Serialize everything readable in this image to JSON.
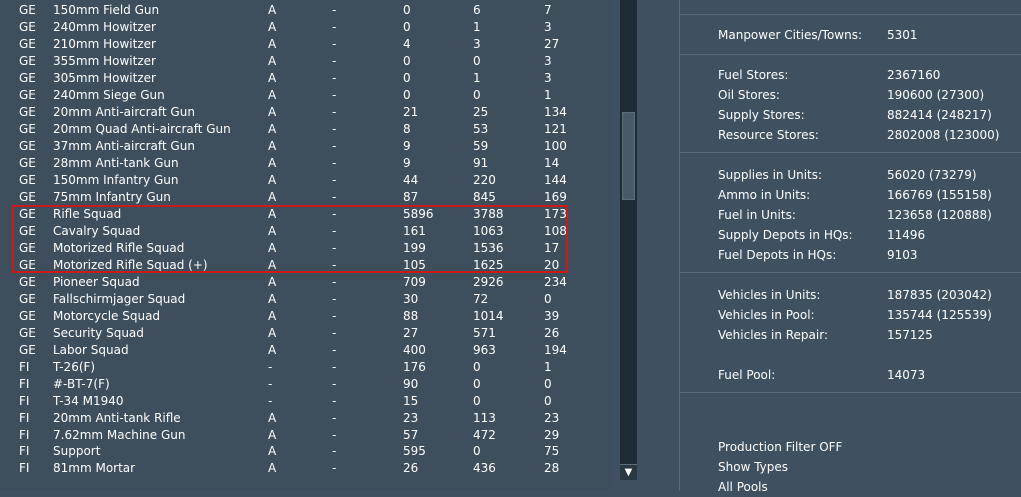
{
  "table": {
    "rows": [
      {
        "nat": "GE",
        "name": "150mm Field Gun",
        "a": "A",
        "d": "-",
        "n1": "0",
        "n2": "6",
        "n3": "7"
      },
      {
        "nat": "GE",
        "name": "240mm Howitzer",
        "a": "A",
        "d": "-",
        "n1": "0",
        "n2": "1",
        "n3": "3"
      },
      {
        "nat": "GE",
        "name": "210mm Howitzer",
        "a": "A",
        "d": "-",
        "n1": "4",
        "n2": "3",
        "n3": "27"
      },
      {
        "nat": "GE",
        "name": "355mm Howitzer",
        "a": "A",
        "d": "-",
        "n1": "0",
        "n2": "0",
        "n3": "3"
      },
      {
        "nat": "GE",
        "name": "305mm Howitzer",
        "a": "A",
        "d": "-",
        "n1": "0",
        "n2": "1",
        "n3": "3"
      },
      {
        "nat": "GE",
        "name": "240mm Siege Gun",
        "a": "A",
        "d": "-",
        "n1": "0",
        "n2": "0",
        "n3": "1"
      },
      {
        "nat": "GE",
        "name": "20mm Anti-aircraft Gun",
        "a": "A",
        "d": "-",
        "n1": "21",
        "n2": "25",
        "n3": "134"
      },
      {
        "nat": "GE",
        "name": "20mm Quad Anti-aircraft Gun",
        "a": "A",
        "d": "-",
        "n1": "8",
        "n2": "53",
        "n3": "121"
      },
      {
        "nat": "GE",
        "name": "37mm Anti-aircraft Gun",
        "a": "A",
        "d": "-",
        "n1": "9",
        "n2": "59",
        "n3": "100"
      },
      {
        "nat": "GE",
        "name": "28mm Anti-tank Gun",
        "a": "A",
        "d": "-",
        "n1": "9",
        "n2": "91",
        "n3": "14"
      },
      {
        "nat": "GE",
        "name": "150mm Infantry Gun",
        "a": "A",
        "d": "-",
        "n1": "44",
        "n2": "220",
        "n3": "144"
      },
      {
        "nat": "GE",
        "name": "75mm Infantry Gun",
        "a": "A",
        "d": "-",
        "n1": "87",
        "n2": "845",
        "n3": "169"
      },
      {
        "nat": "GE",
        "name": "Rifle Squad",
        "a": "A",
        "d": "-",
        "n1": "5896",
        "n2": "3788",
        "n3": "173"
      },
      {
        "nat": "GE",
        "name": "Cavalry Squad",
        "a": "A",
        "d": "-",
        "n1": "161",
        "n2": "1063",
        "n3": "108"
      },
      {
        "nat": "GE",
        "name": "Motorized Rifle Squad",
        "a": "A",
        "d": "-",
        "n1": "199",
        "n2": "1536",
        "n3": "17"
      },
      {
        "nat": "GE",
        "name": "Motorized Rifle Squad (+)",
        "a": "A",
        "d": "-",
        "n1": "105",
        "n2": "1625",
        "n3": "20"
      },
      {
        "nat": "GE",
        "name": "Pioneer Squad",
        "a": "A",
        "d": "-",
        "n1": "709",
        "n2": "2926",
        "n3": "234"
      },
      {
        "nat": "GE",
        "name": "Fallschirmjager Squad",
        "a": "A",
        "d": "-",
        "n1": "30",
        "n2": "72",
        "n3": "0"
      },
      {
        "nat": "GE",
        "name": "Motorcycle Squad",
        "a": "A",
        "d": "-",
        "n1": "88",
        "n2": "1014",
        "n3": "39"
      },
      {
        "nat": "GE",
        "name": "Security Squad",
        "a": "A",
        "d": "-",
        "n1": "27",
        "n2": "571",
        "n3": "26"
      },
      {
        "nat": "GE",
        "name": "Labor Squad",
        "a": "A",
        "d": "-",
        "n1": "400",
        "n2": "963",
        "n3": "194"
      },
      {
        "nat": "FI",
        "name": "T-26(F)",
        "a": "-",
        "d": "-",
        "n1": "176",
        "n2": "0",
        "n3": "1"
      },
      {
        "nat": "FI",
        "name": "#-BT-7(F)",
        "a": "-",
        "d": "-",
        "n1": "90",
        "n2": "0",
        "n3": "0"
      },
      {
        "nat": "FI",
        "name": "T-34 M1940",
        "a": "-",
        "d": "-",
        "n1": "15",
        "n2": "0",
        "n3": "0"
      },
      {
        "nat": "FI",
        "name": "20mm Anti-tank Rifle",
        "a": "A",
        "d": "-",
        "n1": "23",
        "n2": "113",
        "n3": "23"
      },
      {
        "nat": "FI",
        "name": "7.62mm Machine Gun",
        "a": "A",
        "d": "-",
        "n1": "57",
        "n2": "472",
        "n3": "29"
      },
      {
        "nat": "FI",
        "name": "Support",
        "a": "A",
        "d": "-",
        "n1": "595",
        "n2": "0",
        "n3": "75"
      },
      {
        "nat": "FI",
        "name": "81mm Mortar",
        "a": "A",
        "d": "-",
        "n1": "26",
        "n2": "436",
        "n3": "28"
      }
    ]
  },
  "scrollbar": {
    "down_arrow": "▼"
  },
  "info": {
    "manpower": {
      "label": "Manpower Cities/Towns:",
      "value": "5301"
    },
    "stores": [
      {
        "label": "Fuel Stores:",
        "value": "2367160"
      },
      {
        "label": "Oil Stores:",
        "value": "190600 (27300)"
      },
      {
        "label": "Supply Stores:",
        "value": "882414 (248217)"
      },
      {
        "label": "Resource Stores:",
        "value": "2802008 (123000)"
      }
    ],
    "units": [
      {
        "label": "Supplies in Units:",
        "value": "56020 (73279)"
      },
      {
        "label": "Ammo in Units:",
        "value": "166769 (155158)"
      },
      {
        "label": "Fuel in Units:",
        "value": "123658 (120888)"
      },
      {
        "label": "Supply Depots in HQs:",
        "value": "11496"
      },
      {
        "label": "Fuel Depots in HQs:",
        "value": "9103"
      }
    ],
    "vehicles": [
      {
        "label": "Vehicles in Units:",
        "value": "187835 (203042)"
      },
      {
        "label": "Vehicles in Pool:",
        "value": "135744 (125539)"
      },
      {
        "label": "Vehicles in Repair:",
        "value": "157125"
      }
    ],
    "fuel_pool": {
      "label": "Fuel Pool:",
      "value": "14073"
    },
    "links": {
      "production_filter": "Production Filter OFF",
      "show_types": "Show Types",
      "all_pools": "All Pools"
    }
  }
}
